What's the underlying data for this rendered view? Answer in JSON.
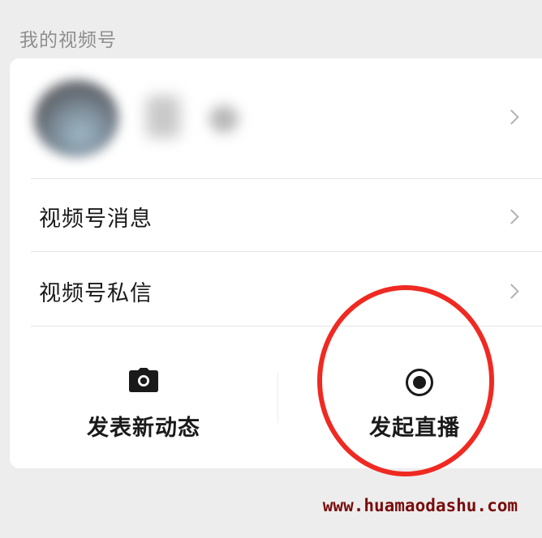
{
  "section": {
    "title": "我的视频号"
  },
  "profile": {
    "avatar_icon": "avatar",
    "name_hidden": true
  },
  "menu": {
    "items": [
      {
        "label": "视频号消息"
      },
      {
        "label": "视频号私信"
      }
    ]
  },
  "actions": {
    "post": {
      "label": "发表新动态",
      "icon": "camera-icon"
    },
    "live": {
      "label": "发起直播",
      "icon": "live-record-icon"
    }
  },
  "annotation": {
    "highlight_color": "#ef2a22"
  },
  "watermark": {
    "text": "www.huamaodashu.com"
  }
}
